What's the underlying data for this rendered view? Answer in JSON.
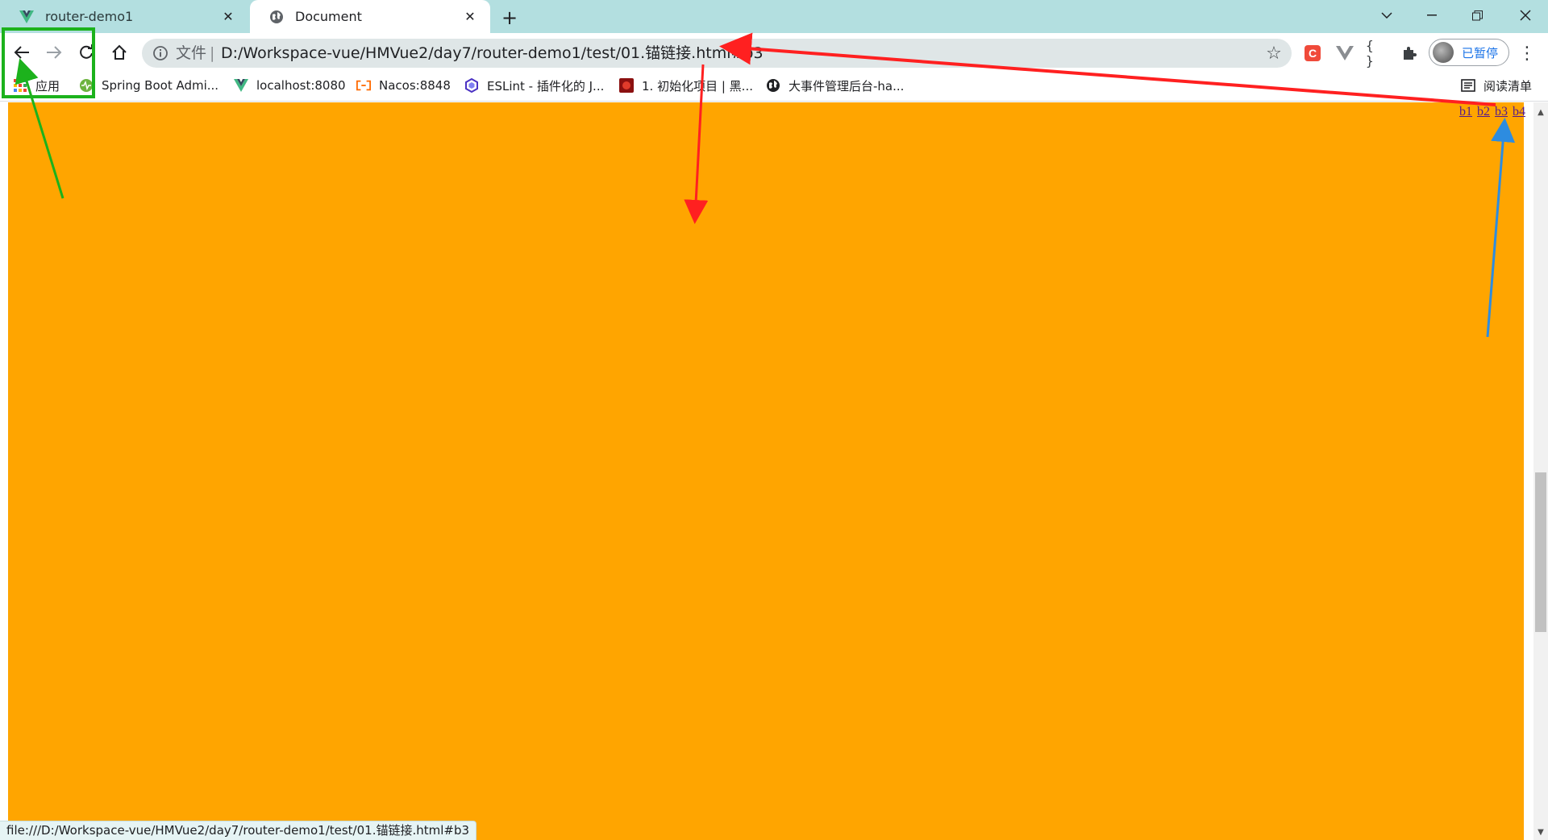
{
  "tabs": [
    {
      "title": "router-demo1",
      "icon": "vue-logo-icon",
      "active": false
    },
    {
      "title": "Document",
      "icon": "globe-icon",
      "active": true
    }
  ],
  "tabstrip": {
    "new_tab_label": "+"
  },
  "toolbar": {
    "scheme_label": "文件",
    "url": "D:/Workspace-vue/HMVue2/day7/router-demo1/test/01.锚链接.html#b3",
    "profile_label": "已暂停"
  },
  "bookmarks": [
    {
      "label": "应用",
      "icon": "apps-grid-icon"
    },
    {
      "label": "Spring Boot Admi...",
      "icon": "spring-boot-admin-icon"
    },
    {
      "label": "localhost:8080",
      "icon": "vue-logo-icon"
    },
    {
      "label": "Nacos:8848",
      "icon": "nacos-icon"
    },
    {
      "label": "ESLint - 插件化的 J...",
      "icon": "eslint-icon"
    },
    {
      "label": "1. 初始化项目 | 黑...",
      "icon": "project-icon"
    },
    {
      "label": "大事件管理后台-ha...",
      "icon": "globe-icon"
    }
  ],
  "reading_list_label": "阅读清单",
  "page": {
    "anchor_links": [
      "b1",
      "b2",
      "b3",
      "b4"
    ],
    "background_color": "#ffa500"
  },
  "status_bar_url": "file:///D:/Workspace-vue/HMVue2/day7/router-demo1/test/01.锚链接.html#b3",
  "colors": {
    "tabstrip": "#b3dfe0",
    "annotation_green": "#1cb21c",
    "annotation_red": "#ff2020",
    "annotation_blue": "#2d8ce0",
    "link_visited": "#551a8b"
  }
}
